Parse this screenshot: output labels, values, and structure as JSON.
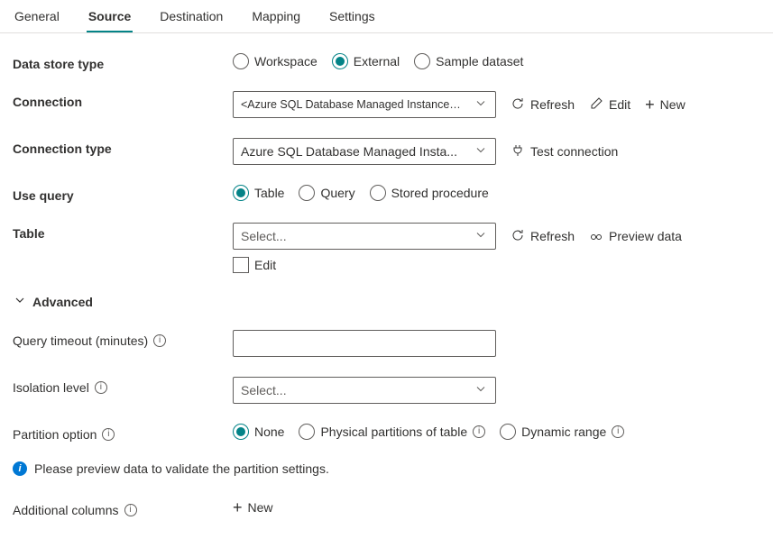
{
  "tabs": {
    "general": "General",
    "source": "Source",
    "destination": "Destination",
    "mapping": "Mapping",
    "settings": "Settings"
  },
  "labels": {
    "dataStoreType": "Data store type",
    "connection": "Connection",
    "connectionType": "Connection type",
    "useQuery": "Use query",
    "table": "Table",
    "advanced": "Advanced",
    "queryTimeout": "Query timeout (minutes)",
    "isolationLevel": "Isolation level",
    "partitionOption": "Partition option",
    "additionalColumns": "Additional columns"
  },
  "dataStoreType": {
    "workspace": "Workspace",
    "external": "External",
    "sample": "Sample dataset"
  },
  "connection": {
    "value": "<Azure SQL Database Managed Instance connection>",
    "refresh": "Refresh",
    "edit": "Edit",
    "new_": "New"
  },
  "connectionType": {
    "value": "Azure SQL Database Managed Insta...",
    "test": "Test connection"
  },
  "useQuery": {
    "table": "Table",
    "query": "Query",
    "sp": "Stored procedure"
  },
  "table": {
    "placeholder": "Select...",
    "editLabel": "Edit",
    "refresh": "Refresh",
    "preview": "Preview data"
  },
  "isolation": {
    "placeholder": "Select..."
  },
  "partition": {
    "none": "None",
    "physical": "Physical partitions of table",
    "dynamic": "Dynamic range"
  },
  "infoMsg": "Please preview data to validate the partition settings.",
  "addColumns": {
    "new_": "New"
  }
}
